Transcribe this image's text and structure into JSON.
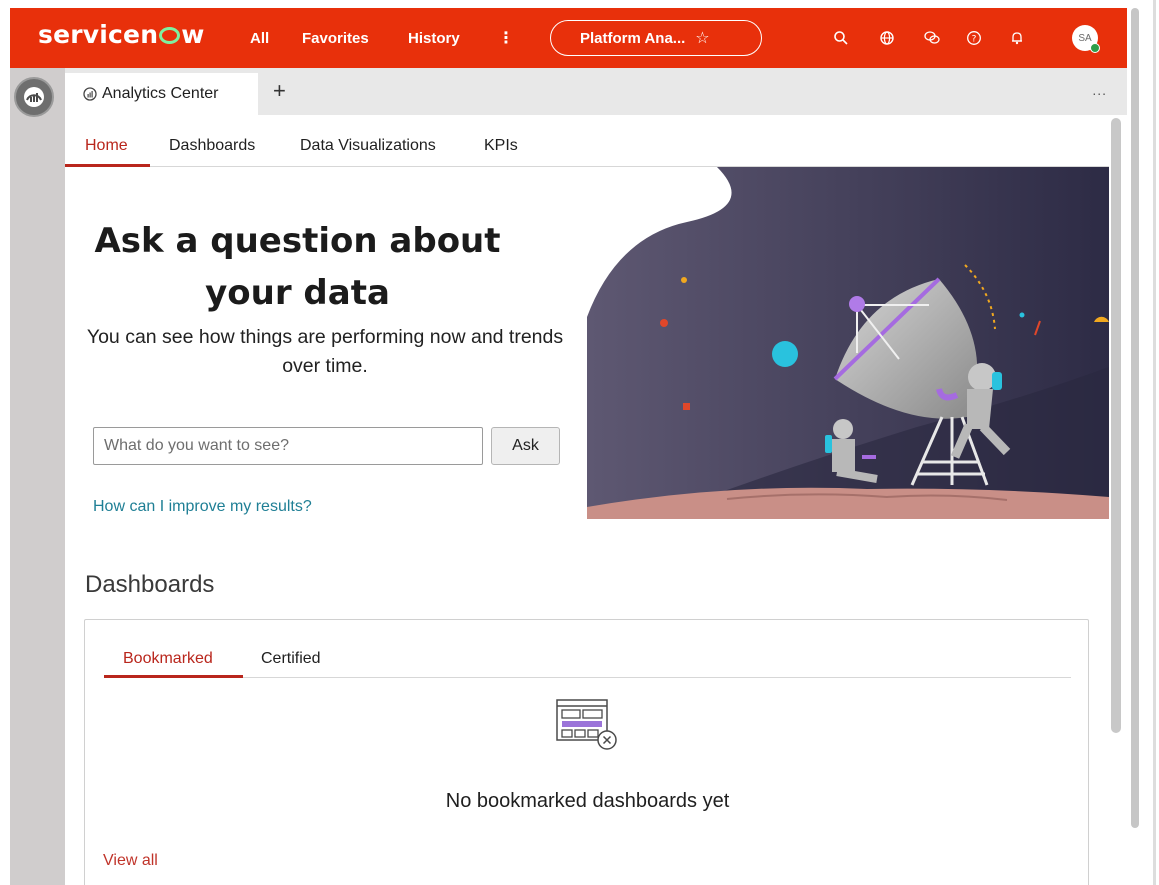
{
  "header": {
    "logo_prefix": "servicen",
    "logo_suffix": "w",
    "nav": [
      "All",
      "Favorites",
      "History"
    ],
    "more_icon": "kebab-vertical-icon",
    "context_pill": "Platform Ana...",
    "icons": [
      "search-icon",
      "globe-icon",
      "chat-icon",
      "help-icon",
      "bell-icon"
    ],
    "avatar_initials": "SA",
    "color": "#e8300b"
  },
  "tabs": {
    "active_label": "Analytics Center",
    "add_label": "+",
    "more_label": "..."
  },
  "subnav": {
    "items": [
      "Home",
      "Dashboards",
      "Data Visualizations",
      "KPIs"
    ],
    "active": "Home"
  },
  "hero": {
    "title": "Ask a question about your data",
    "subtitle": "You can see how things are performing now and trends over time.",
    "input_placeholder": "What do you want to see?",
    "ask_label": "Ask",
    "help_link": "How can I improve my results?"
  },
  "dashboards": {
    "title": "Dashboards",
    "tabs": [
      "Bookmarked",
      "Certified"
    ],
    "active_tab": "Bookmarked",
    "empty_text": "No bookmarked dashboards yet",
    "view_all": "View all"
  },
  "colors": {
    "accent_red": "#b9261c",
    "link_teal": "#1f7f95"
  }
}
